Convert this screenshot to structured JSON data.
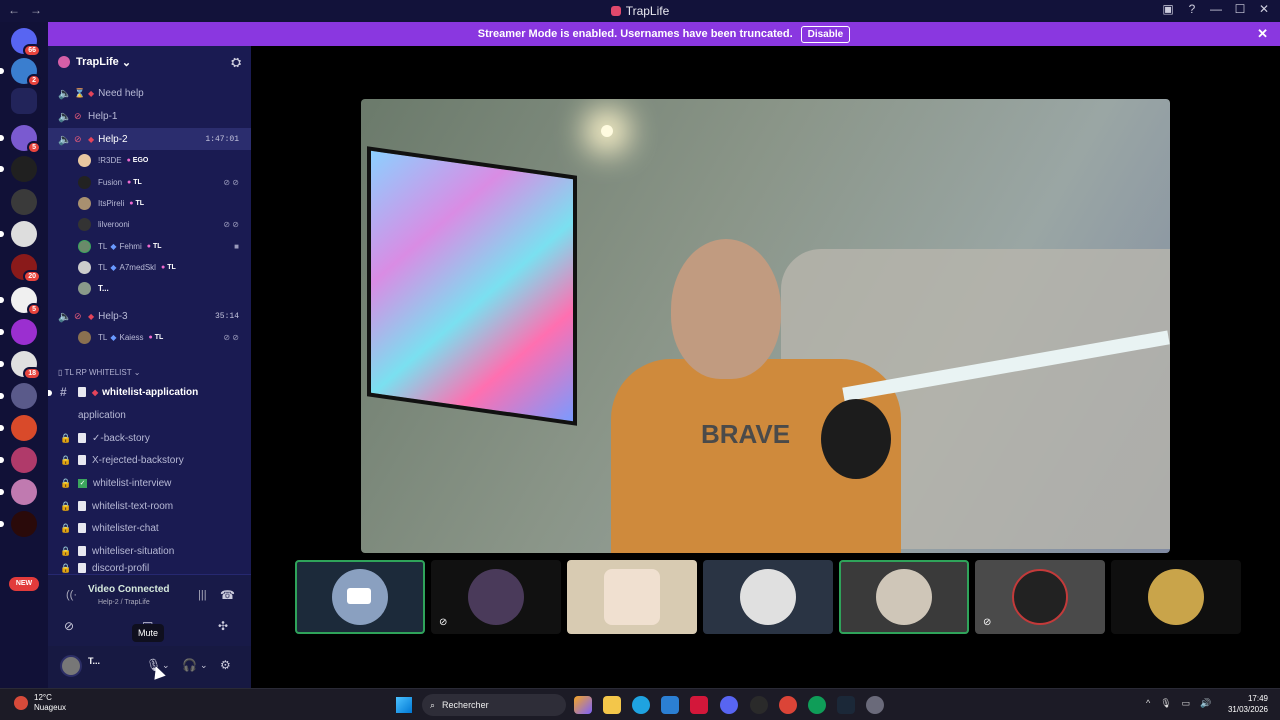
{
  "titlebar": {
    "back": "←",
    "forward": "→",
    "title": "TrapLife",
    "icons": [
      "inbox-icon",
      "help-icon"
    ],
    "min": "—",
    "max": "☐",
    "close": "✕"
  },
  "banner": {
    "text": "Streamer Mode is enabled. Usernames have been truncated.",
    "button": "Disable",
    "close": "✕"
  },
  "guilds": [
    {
      "badge": "66"
    },
    {
      "badge": "2"
    },
    {
      "badge": ""
    },
    {
      "badge": "5"
    },
    {
      "badge": ""
    },
    {
      "badge": ""
    },
    {
      "badge": ""
    },
    {
      "badge": "20"
    },
    {
      "badge": "5"
    },
    {
      "badge": ""
    },
    {
      "badge": "18"
    },
    {
      "badge": ""
    },
    {
      "badge": ""
    },
    {
      "badge": ""
    },
    {
      "badge": ""
    },
    {
      "badge": ""
    }
  ],
  "guild_new": "NEW",
  "server": {
    "name": "TrapLife"
  },
  "voice_channels": [
    {
      "name": "Need help",
      "time": ""
    },
    {
      "name": "Help-1",
      "time": ""
    },
    {
      "name": "Help-2",
      "time": "1:47:01"
    },
    {
      "name": "Help-3",
      "time": "35:14"
    }
  ],
  "help2_users": [
    {
      "name": "!R3DE",
      "tag": "EGO",
      "prefix": ""
    },
    {
      "name": "Fusion",
      "tag": "TL",
      "prefix": ""
    },
    {
      "name": "ItsPireli",
      "tag": "TL",
      "prefix": ""
    },
    {
      "name": "lilverooni",
      "tag": "",
      "prefix": ""
    },
    {
      "name": "Fehmi",
      "tag": "TL",
      "prefix": "TL"
    },
    {
      "name": "A7medSkl",
      "tag": "TL",
      "prefix": "TL"
    },
    {
      "name": "T...",
      "tag": "",
      "prefix": ""
    }
  ],
  "help3_users": [
    {
      "name": "Kaiess",
      "tag": "TL",
      "prefix": "TL"
    }
  ],
  "category": "TL RP WHITELIST",
  "text_channels": [
    {
      "name": "whitelist-application",
      "lock": false
    },
    {
      "name": "application",
      "lock": true
    },
    {
      "name": "✓-back-story",
      "lock": true
    },
    {
      "name": "X-rejected-backstory",
      "lock": true
    },
    {
      "name": "whitelist-interview",
      "lock": true
    },
    {
      "name": "whitelist-text-room",
      "lock": true
    },
    {
      "name": "whitelister-chat",
      "lock": true
    },
    {
      "name": "whiteliser-situation",
      "lock": true
    },
    {
      "name": "discord-profil",
      "lock": true
    }
  ],
  "voice_status": {
    "title": "Video Connected",
    "sub": "Help-2 / TrapLife"
  },
  "tooltip": "Mute",
  "user_panel": {
    "name": "T..."
  },
  "taskbar": {
    "weather_temp": "12°C",
    "weather_desc": "Nuageux",
    "search": "Rechercher",
    "time": "17:49",
    "date": "31/03/2026"
  },
  "colors": {
    "accent": "#8a37e0",
    "sidebar": "#1a1b52",
    "speaking": "#2fa35a"
  }
}
